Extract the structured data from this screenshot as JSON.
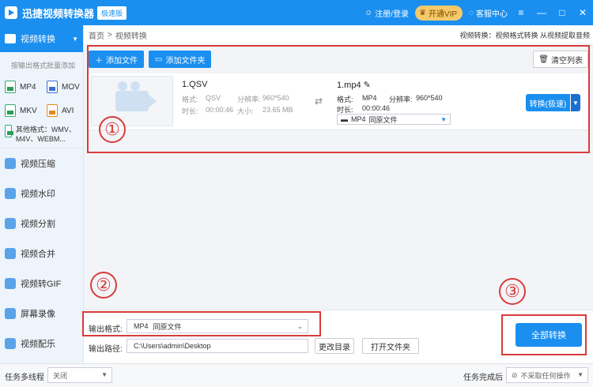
{
  "app": {
    "title": "迅捷视频转换器",
    "badge": "极速版",
    "login": "注册/登录",
    "vip": "开通VIP",
    "service": "客服中心",
    "colors": {
      "primary": "#1a8ff0",
      "annotation": "#d93b3b",
      "vip": "#f6c96a"
    }
  },
  "sidebar": {
    "active": "视频转换",
    "hint": "按输出格式批量添加",
    "formats": [
      "MP4",
      "MOV",
      "MKV",
      "AVI"
    ],
    "other_formats": "其他格式：WMV、M4V、WEBM...",
    "items": [
      "视频压缩",
      "视频水印",
      "视频分割",
      "视频合并",
      "视频转GIF",
      "屏幕录像",
      "视频配乐"
    ]
  },
  "breadcrumb": {
    "home": "首页",
    "sep": ">",
    "current": "视频转换"
  },
  "feature_desc": "视频转换：视频格式转换 从视频提取音频",
  "toolbar": {
    "add_file": "添加文件",
    "add_folder": "添加文件夹",
    "clear": "清空列表"
  },
  "file": {
    "src_name": "1.QSV",
    "format_label": "格式:",
    "format": "QSV",
    "res_label": "分辨率:",
    "res": "960*540",
    "dur_label": "时长:",
    "dur": "00:00:46",
    "size_label": "大小:",
    "size": "23.65 MB",
    "dst_name": "1.mp4",
    "dst_format": "MP4",
    "dst_res": "960*540",
    "dst_dur": "00:00:46",
    "dst_select_format": "MP4",
    "dst_select_quality": "同原文件",
    "convert": "转换(极速)"
  },
  "annotations": [
    "①",
    "②",
    "③"
  ],
  "output": {
    "format_label": "输出格式:",
    "format_value": "MP4",
    "format_quality": "同原文件",
    "path_label": "输出路径:",
    "path_value": "C:\\Users\\admin\\Desktop",
    "change_dir": "更改目录",
    "open_folder": "打开文件夹",
    "convert_all": "全部转换"
  },
  "status": {
    "multithread_label": "任务多线程",
    "multithread_value": "关闭",
    "after_label": "任务完成后",
    "after_value": "不采取任何操作"
  }
}
